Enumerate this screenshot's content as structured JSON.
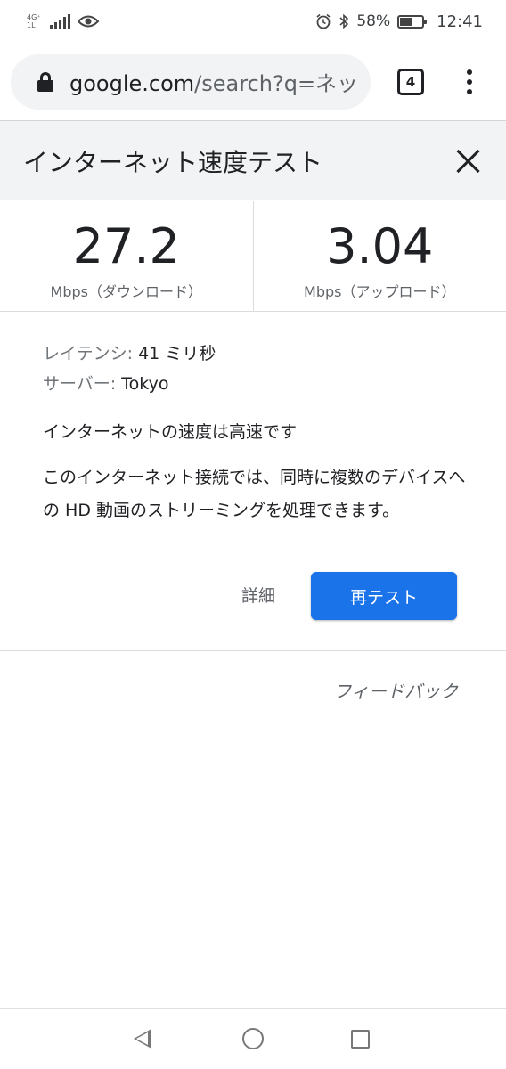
{
  "status_bar": {
    "network": "4G⁺",
    "network_sub": "1L",
    "battery": "58%",
    "battery_level": 0.58,
    "time": "12:41",
    "icons": [
      "signal-icon",
      "eye-icon",
      "alarm-icon",
      "bluetooth-icon",
      "battery-icon"
    ]
  },
  "browser": {
    "url_main": "google.com",
    "url_rest": "/search?q=ネット",
    "tab_count": "4"
  },
  "card": {
    "title": "インターネット速度テスト",
    "download": {
      "value": "27.2",
      "unit": "Mbps（ダウンロード）"
    },
    "upload": {
      "value": "3.04",
      "unit": "Mbps（アップロード）"
    },
    "latency_label": "レイテンシ:",
    "latency_value": "41 ミリ秒",
    "server_label": "サーバー:",
    "server_value": "Tokyo",
    "summary": "インターネットの速度は高速です",
    "description": "このインターネット接続では、同時に複数のデバイスへの HD 動画のストリーミングを処理できます。",
    "details_label": "詳細",
    "retest_label": "再テスト",
    "accent_color": "#1a73e8"
  },
  "feedback_label": "フィードバック"
}
